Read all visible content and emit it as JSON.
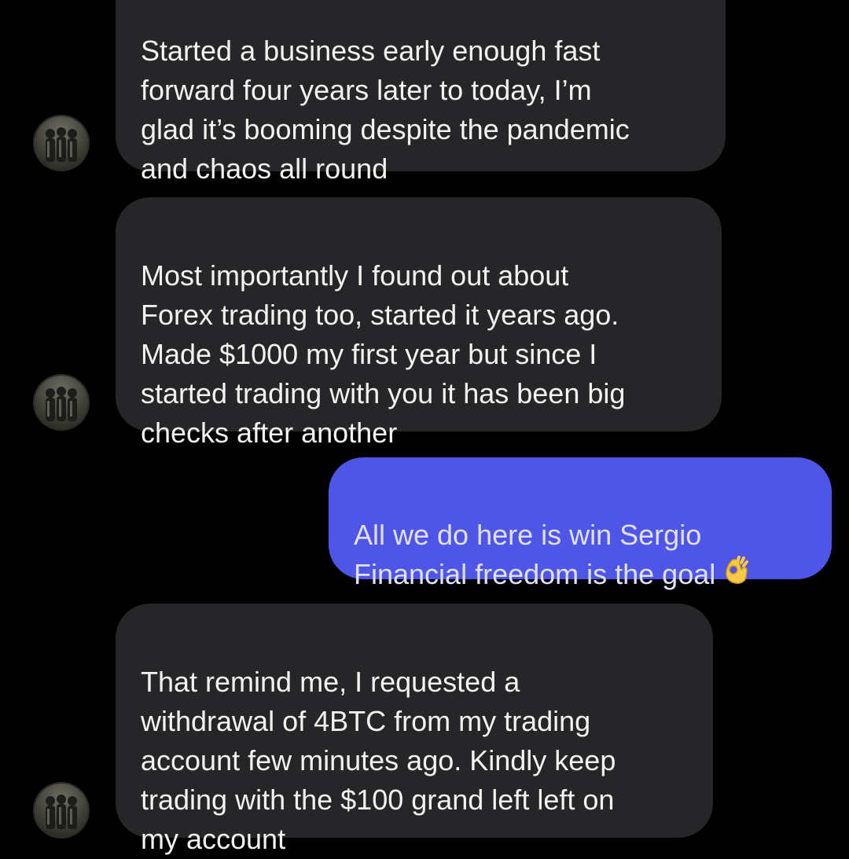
{
  "messages": [
    {
      "direction": "incoming",
      "text": "Started a business early enough fast\nforward four years later to today, I’m\nglad it’s booming despite the pandemic\nand chaos all round"
    },
    {
      "direction": "incoming",
      "text": "Most importantly I found out about\nForex trading too, started it years ago.\nMade $1000 my first year but since I\nstarted trading with you it has been big\nchecks after another"
    },
    {
      "direction": "outgoing",
      "text": "All we do here is win Sergio\nFinancial freedom is the goal",
      "emoji": "ok-hand-emoji-icon"
    },
    {
      "direction": "incoming",
      "text": "That remind me, I requested a\nwithdrawal of 4BTC from my trading\naccount few minutes ago. Kindly keep\ntrading with the $100 grand left left on\nmy account"
    }
  ],
  "colors": {
    "background": "#000000",
    "incoming_bubble": "#262628",
    "outgoing_bubble": "#4f55e6",
    "text": "#f2f2f2"
  }
}
